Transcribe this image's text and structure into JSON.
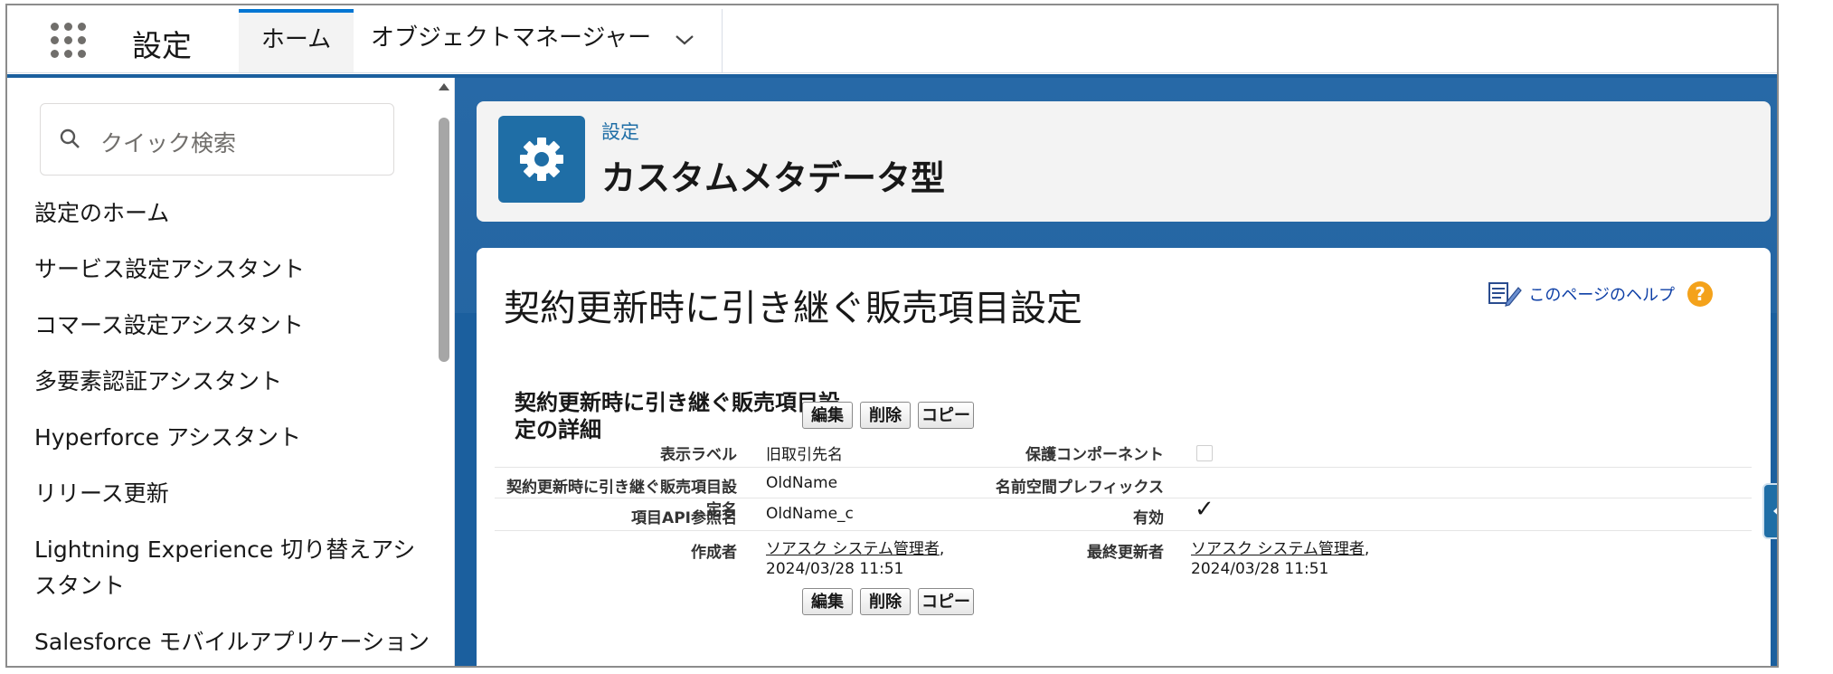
{
  "app": {
    "title": "設定"
  },
  "tabs": [
    {
      "label": "ホーム",
      "active": true
    },
    {
      "label": "オブジェクトマネージャー",
      "active": false
    }
  ],
  "sidebar": {
    "search_placeholder": "クイック検索",
    "items": [
      {
        "label": "設定のホーム"
      },
      {
        "label": "サービス設定アシスタント"
      },
      {
        "label": "コマース設定アシスタント"
      },
      {
        "label": "多要素認証アシスタント"
      },
      {
        "label": "Hyperforce アシスタント"
      },
      {
        "label": "リリース更新"
      },
      {
        "label": "Lightning Experience 切り替えアシスタント"
      },
      {
        "label": "Salesforce モバイルアプリケーション"
      }
    ]
  },
  "header": {
    "breadcrumb": "設定",
    "title": "カスタムメタデータ型"
  },
  "page": {
    "title": "契約更新時に引き継ぐ販売項目設定",
    "help_link": "このページのヘルプ"
  },
  "detail": {
    "title": "契約更新時に引き継ぐ販売項目設定の詳細",
    "buttons": {
      "edit": "編集",
      "delete": "削除",
      "copy": "コピー"
    },
    "fields": {
      "display_label": {
        "label": "表示ラベル",
        "value": "旧取引先名"
      },
      "protected_component": {
        "label": "保護コンポーネント",
        "checked": false
      },
      "record_name": {
        "label": "契約更新時に引き継ぐ販売項目設定名",
        "value": "OldName"
      },
      "namespace_prefix": {
        "label": "名前空間プレフィックス",
        "value": ""
      },
      "api_ref": {
        "label": "項目API参照名",
        "value": "OldName_c"
      },
      "active": {
        "label": "有効",
        "checked": true
      },
      "created_by": {
        "label": "作成者",
        "user": "ソアスク システム管理者",
        "datetime": ", 2024/03/28 11:51"
      },
      "modified_by": {
        "label": "最終更新者",
        "user": "ソアスク システム管理者",
        "datetime": ", 2024/03/28 11:51"
      }
    }
  },
  "colors": {
    "brand": "#1b5f9e",
    "accent_tab": "#0176d3",
    "help_icon": "#f4a21b"
  }
}
